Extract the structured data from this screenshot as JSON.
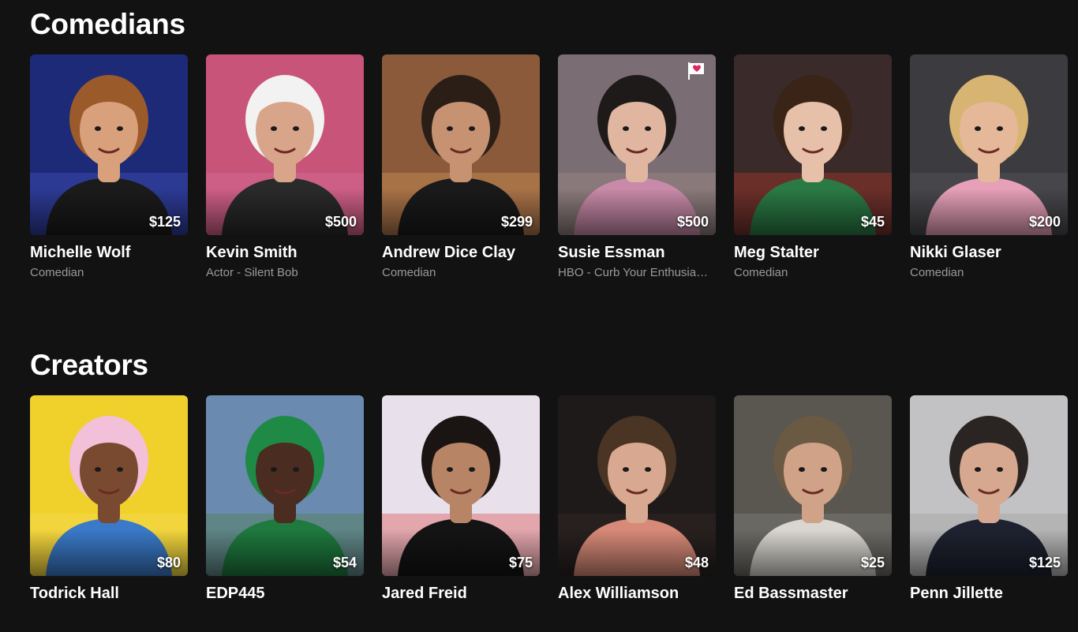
{
  "sections": [
    {
      "title": "Comedians",
      "cards": [
        {
          "name": "Michelle Wolf",
          "subtitle": "Comedian",
          "price": "$125",
          "bg": "#1d2a78",
          "accent": "#4b5ac8",
          "skin": "#d9a07c",
          "hair": "#9b5a2a",
          "shirt": "#1b1b1b"
        },
        {
          "name": "Kevin Smith",
          "subtitle": "Actor - Silent Bob",
          "price": "$500",
          "bg": "#c8547a",
          "accent": "#d8739a",
          "skin": "#d9a58a",
          "hair": "#f2f2f2",
          "shirt": "#2a2a2a"
        },
        {
          "name": "Andrew Dice Clay",
          "subtitle": "Comedian",
          "price": "$299",
          "bg": "#8a5a3a",
          "accent": "#e0a060",
          "skin": "#c79272",
          "hair": "#2a1e16",
          "shirt": "#1a1a1a"
        },
        {
          "name": "Susie Essman",
          "subtitle": "HBO - Curb Your Enthusiasm",
          "price": "$500",
          "bg": "#7a6e74",
          "accent": "#a89088",
          "skin": "#e0b6a0",
          "hair": "#1e1a1a",
          "shirt": "#c88aa8"
        },
        {
          "name": "Meg Stalter",
          "subtitle": "Comedian",
          "price": "$45",
          "bg": "#3a2a2a",
          "accent": "#c83a2a",
          "skin": "#e6c0a8",
          "hair": "#3a2418",
          "shirt": "#2a7a44"
        },
        {
          "name": "Nikki Glaser",
          "subtitle": "Comedian",
          "price": "$200",
          "bg": "#3c3c40",
          "accent": "#5a5a60",
          "skin": "#e4b898",
          "hair": "#d8b472",
          "shirt": "#e6a0b8"
        }
      ]
    },
    {
      "title": "Creators",
      "cards": [
        {
          "name": "Todrick Hall",
          "subtitle": "",
          "price": "$80",
          "bg": "#f0d02a",
          "accent": "#f6e060",
          "skin": "#7a4a30",
          "hair": "#f2c0d8",
          "shirt": "#3a7ac8"
        },
        {
          "name": "EDP445",
          "subtitle": "",
          "price": "$54",
          "bg": "#6a8ab0",
          "accent": "#4a7a3a",
          "skin": "#4a2c20",
          "hair": "#1e8a46",
          "shirt": "#1e7a3e"
        },
        {
          "name": "Jared Freid",
          "subtitle": "",
          "price": "$75",
          "bg": "#e8e0ea",
          "accent": "#d83a3a",
          "skin": "#b88466",
          "hair": "#1a1412",
          "shirt": "#141414"
        },
        {
          "name": "Alex Williamson",
          "subtitle": "",
          "price": "$48",
          "bg": "#1e1a1a",
          "accent": "#3a2e2a",
          "skin": "#d8a890",
          "hair": "#4a3424",
          "shirt": "#d88a78"
        },
        {
          "name": "Ed Bassmaster",
          "subtitle": "",
          "price": "$25",
          "bg": "#5a5650",
          "accent": "#8a8a86",
          "skin": "#d0a288",
          "hair": "#6a5a44",
          "shirt": "#dad6d0"
        },
        {
          "name": "Penn Jillette",
          "subtitle": "",
          "price": "$125",
          "bg": "#c2c2c4",
          "accent": "#9a9a9c",
          "skin": "#d6a890",
          "hair": "#2a2422",
          "shirt": "#1e2230"
        }
      ]
    }
  ],
  "favorite_badge": {
    "icon": "heart-flag-icon",
    "on_card": "Susie Essman",
    "color": "#e0245e"
  }
}
